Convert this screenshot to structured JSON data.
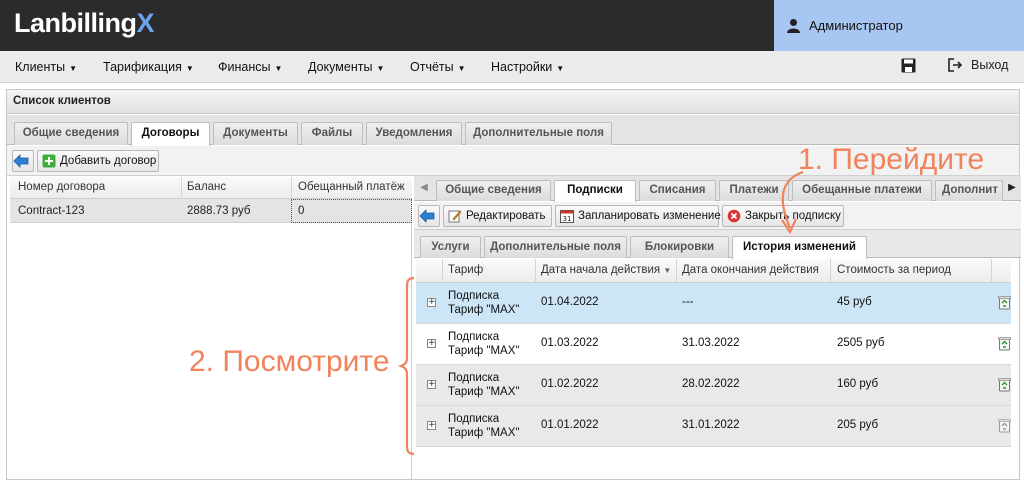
{
  "header": {
    "logo_main": "Lanbilling",
    "logo_accent": "X",
    "user_name": "Администратор"
  },
  "menu": {
    "items": [
      {
        "label": "Клиенты"
      },
      {
        "label": "Тарификация"
      },
      {
        "label": "Финансы"
      },
      {
        "label": "Документы"
      },
      {
        "label": "Отчёты"
      },
      {
        "label": "Настройки"
      }
    ],
    "logout_label": "Выход"
  },
  "panel": {
    "title": "Список клиентов",
    "tabs": [
      {
        "label": "Общие сведения"
      },
      {
        "label": "Договоры"
      },
      {
        "label": "Документы"
      },
      {
        "label": "Файлы"
      },
      {
        "label": "Уведомления"
      },
      {
        "label": "Дополнительные поля"
      }
    ],
    "add_contract_label": "Добавить договор"
  },
  "contracts_grid": {
    "columns": [
      "Номер договора",
      "Баланс",
      "Обещанный платёж"
    ],
    "rows": [
      {
        "number": "Contract-123",
        "balance": "2888.73 руб",
        "promised": "0"
      }
    ]
  },
  "contract_tabs": [
    {
      "label": "Общие сведения"
    },
    {
      "label": "Подписки"
    },
    {
      "label": "Списания"
    },
    {
      "label": "Платежи"
    },
    {
      "label": "Обещанные платежи"
    },
    {
      "label": "Дополнит"
    }
  ],
  "subscription_toolbar": {
    "edit_label": "Редактировать",
    "schedule_label": "Запланировать изменение",
    "close_label": "Закрыть подписку"
  },
  "subscription_subtabs": [
    {
      "label": "Услуги"
    },
    {
      "label": "Дополнительные поля"
    },
    {
      "label": "Блокировки"
    },
    {
      "label": "История изменений"
    }
  ],
  "history_grid": {
    "columns": [
      "Тариф",
      "Дата начала действия",
      "Дата окончания действия",
      "Стоимость за период"
    ],
    "rows": [
      {
        "tarif_line1": "Подписка",
        "tarif_line2": "Тариф \"MAX\"",
        "start": "01.04.2022",
        "end": "---",
        "cost": "45 руб"
      },
      {
        "tarif_line1": "Подписка",
        "tarif_line2": "Тариф \"MAX\"",
        "start": "01.03.2022",
        "end": "31.03.2022",
        "cost": "2505 руб"
      },
      {
        "tarif_line1": "Подписка",
        "tarif_line2": "Тариф \"MAX\"",
        "start": "01.02.2022",
        "end": "28.02.2022",
        "cost": "160 руб"
      },
      {
        "tarif_line1": "Подписка",
        "tarif_line2": "Тариф \"MAX\"",
        "start": "01.01.2022",
        "end": "31.01.2022",
        "cost": "205 руб"
      }
    ]
  },
  "annotations": {
    "step1": "1. Перейдите",
    "step2": "2. Посмотрите"
  },
  "colors": {
    "header_bg": "#2b2b2b",
    "logo_accent": "#6aa3f0",
    "user_bg": "#a8c6f2",
    "selected_row": "#cde6f7",
    "annotation": "#f0825c"
  }
}
